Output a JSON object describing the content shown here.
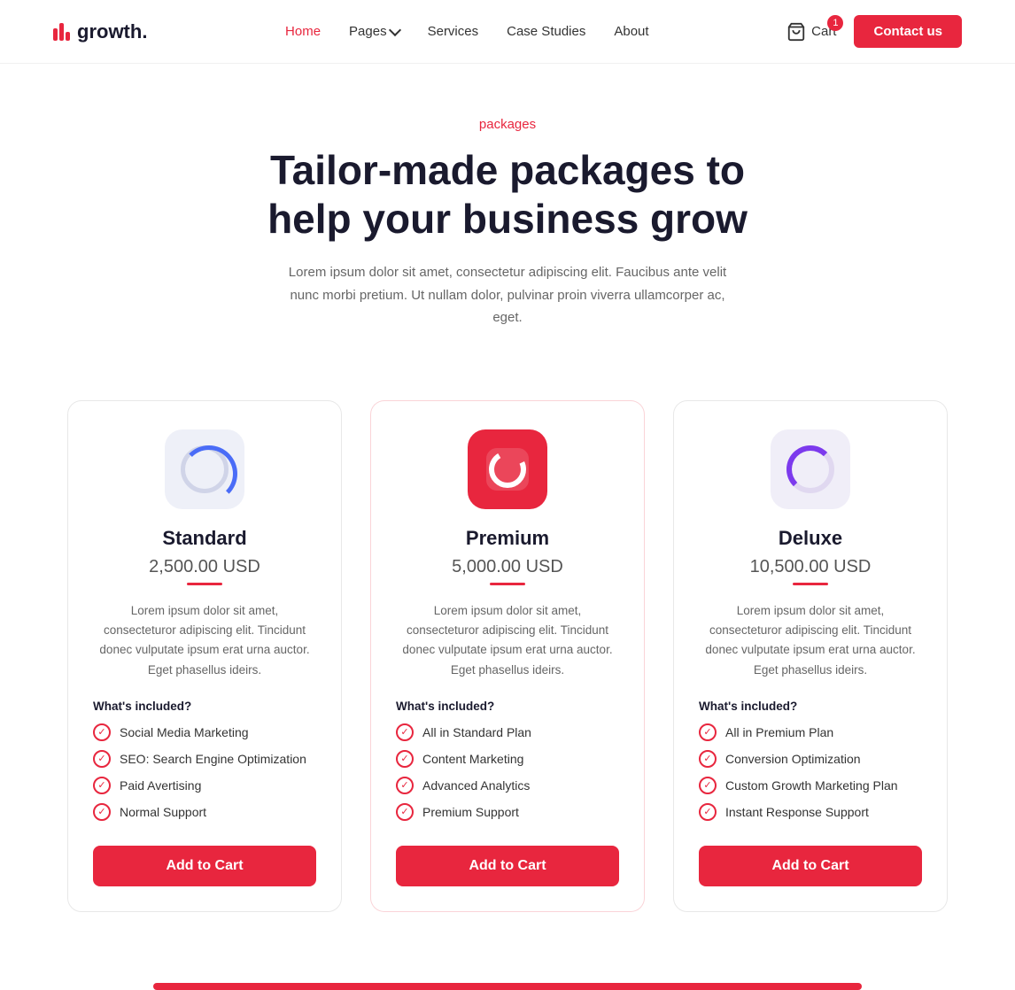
{
  "nav": {
    "logo_text": "growth.",
    "links": [
      {
        "label": "Home",
        "active": true
      },
      {
        "label": "Pages",
        "has_dropdown": true
      },
      {
        "label": "Services",
        "active": false
      },
      {
        "label": "Case Studies",
        "active": false
      },
      {
        "label": "About",
        "active": false
      }
    ],
    "cart_label": "Cart",
    "cart_count": "1",
    "contact_label": "Contact us"
  },
  "hero": {
    "label": "packages",
    "title_line1": "Tailor-made packages to",
    "title_line2": "help your business grow",
    "description": "Lorem ipsum dolor sit amet, consectetur adipiscing elit. Faucibus ante velit nunc morbi pretium. Ut nullam dolor, pulvinar proin viverra ullamcorper ac, eget."
  },
  "packages": [
    {
      "id": "standard",
      "name": "Standard",
      "price": "2,500.00 USD",
      "description": "Lorem ipsum dolor sit amet, consecteturor adipiscing elit. Tincidunt donec vulputate ipsum erat urna auctor. Eget phasellus ideirs.",
      "included_title": "What's included?",
      "features": [
        "Social Media Marketing",
        "SEO: Search Engine Optimization",
        "Paid Avertising",
        "Normal Support"
      ],
      "cta": "Add to Cart",
      "icon_type": "standard"
    },
    {
      "id": "premium",
      "name": "Premium",
      "price": "5,000.00 USD",
      "description": "Lorem ipsum dolor sit amet, consecteturor adipiscing elit. Tincidunt donec vulputate ipsum erat urna auctor. Eget phasellus ideirs.",
      "included_title": "What's included?",
      "features": [
        "All in Standard Plan",
        "Content Marketing",
        "Advanced Analytics",
        "Premium Support"
      ],
      "cta": "Add to Cart",
      "icon_type": "premium"
    },
    {
      "id": "deluxe",
      "name": "Deluxe",
      "price": "10,500.00 USD",
      "description": "Lorem ipsum dolor sit amet, consecteturor adipiscing elit. Tincidunt donec vulputate ipsum erat urna auctor. Eget phasellus ideirs.",
      "included_title": "What's included?",
      "features": [
        "All in Premium Plan",
        "Conversion Optimization",
        "Custom Growth Marketing Plan",
        "Instant Response Support"
      ],
      "cta": "Add to Cart",
      "icon_type": "deluxe"
    }
  ],
  "colors": {
    "accent": "#e8263e",
    "dark": "#1a1a2e",
    "text": "#666"
  }
}
